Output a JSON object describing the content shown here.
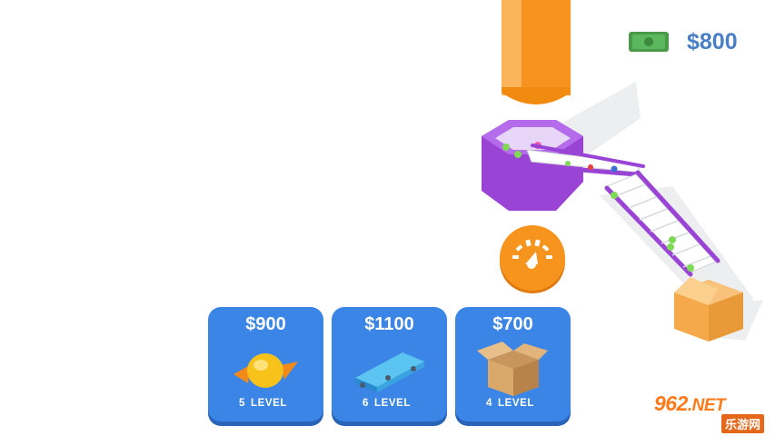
{
  "hud": {
    "money": "$800"
  },
  "upgrades": [
    {
      "price": "$900",
      "level_num": "5",
      "level_word": "LEVEL",
      "icon": "candy-icon"
    },
    {
      "price": "$1100",
      "level_num": "6",
      "level_word": "LEVEL",
      "icon": "conveyor-icon"
    },
    {
      "price": "$700",
      "level_num": "4",
      "level_word": "LEVEL",
      "icon": "box-icon"
    }
  ],
  "watermark": {
    "top": "962",
    "net": ".NET",
    "bottom": "乐游网"
  },
  "colors": {
    "card_blue": "#3b85e6",
    "money_text": "#4a7fc8",
    "pipe_orange": "#f7931e",
    "machine_purple": "#a450e0",
    "button_orange": "#f7941d",
    "box_orange": "#f6a94a"
  }
}
